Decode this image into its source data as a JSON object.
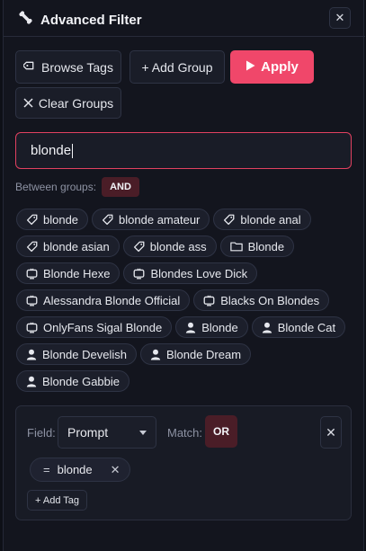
{
  "panel": {
    "title": "Advanced Filter",
    "close_label": "✕"
  },
  "toolbar": {
    "browse_tags": "Browse Tags",
    "add_group": "+ Add Group",
    "apply": "Apply",
    "clear_groups": "Clear Groups"
  },
  "search": {
    "value": "blonde"
  },
  "between": {
    "label": "Between groups:",
    "mode": "AND"
  },
  "suggestions": [
    {
      "label": "blonde",
      "icon": "tag-icon"
    },
    {
      "label": "blonde amateur",
      "icon": "tag-icon"
    },
    {
      "label": "blonde anal",
      "icon": "tag-icon"
    },
    {
      "label": "blonde asian",
      "icon": "tag-icon"
    },
    {
      "label": "blonde ass",
      "icon": "tag-icon"
    },
    {
      "label": "Blonde",
      "icon": "folder-icon"
    },
    {
      "label": "Blonde Hexe",
      "icon": "tv-icon"
    },
    {
      "label": "Blondes Love Dick",
      "icon": "tv-icon"
    },
    {
      "label": "Alessandra Blonde Official",
      "icon": "tv-icon"
    },
    {
      "label": "Blacks On Blondes",
      "icon": "tv-icon"
    },
    {
      "label": "OnlyFans Sigal Blonde",
      "icon": "tv-icon"
    },
    {
      "label": "Blonde",
      "icon": "person-icon"
    },
    {
      "label": "Blonde Cat",
      "icon": "person-icon"
    },
    {
      "label": "Blonde Develish",
      "icon": "person-icon"
    },
    {
      "label": "Blonde Dream",
      "icon": "person-icon"
    },
    {
      "label": "Blonde Gabbie",
      "icon": "person-icon"
    }
  ],
  "group": {
    "field_label": "Field:",
    "field_value": "Prompt",
    "match_label": "Match:",
    "match_value": "OR",
    "remove_label": "✕",
    "conditions": [
      {
        "op": "=",
        "value": "blonde",
        "remove": "✕"
      }
    ],
    "add_tag": "+ Add Tag"
  },
  "colors": {
    "accent": "#f0476a",
    "badge_bg": "#4a1d27",
    "panel_bg": "#13151e"
  }
}
